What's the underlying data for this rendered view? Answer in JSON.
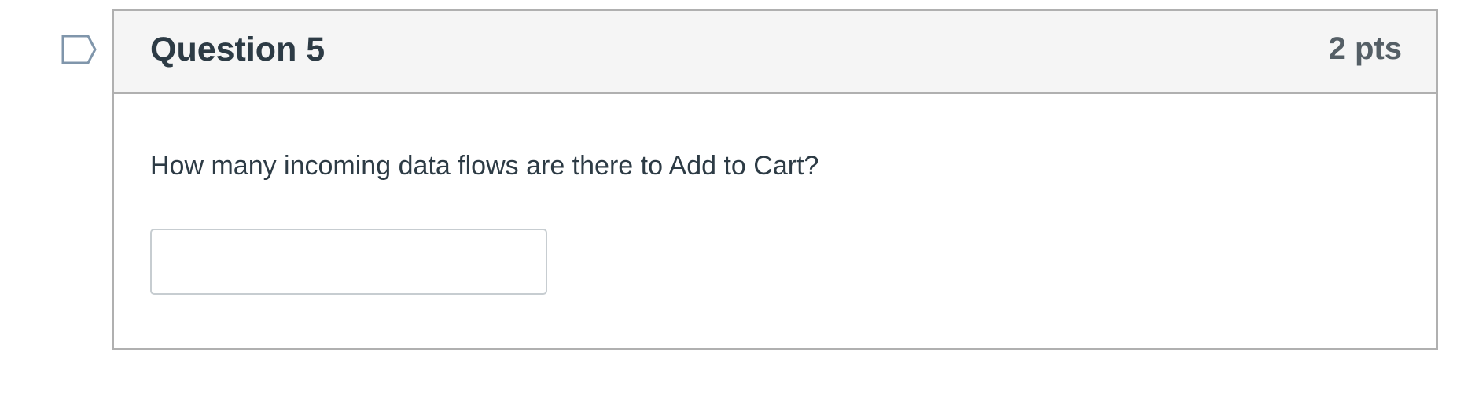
{
  "question": {
    "title": "Question 5",
    "points": "2 pts",
    "text": "How many incoming data flows are there to Add to Cart?",
    "answer_value": "",
    "answer_placeholder": ""
  },
  "icons": {
    "flag": "flag-question-icon"
  },
  "colors": {
    "header_bg": "#f5f5f5",
    "border": "#b0b0b0",
    "text": "#2d3b45",
    "points_text": "#555f66",
    "flag_stroke": "#8096ab"
  }
}
